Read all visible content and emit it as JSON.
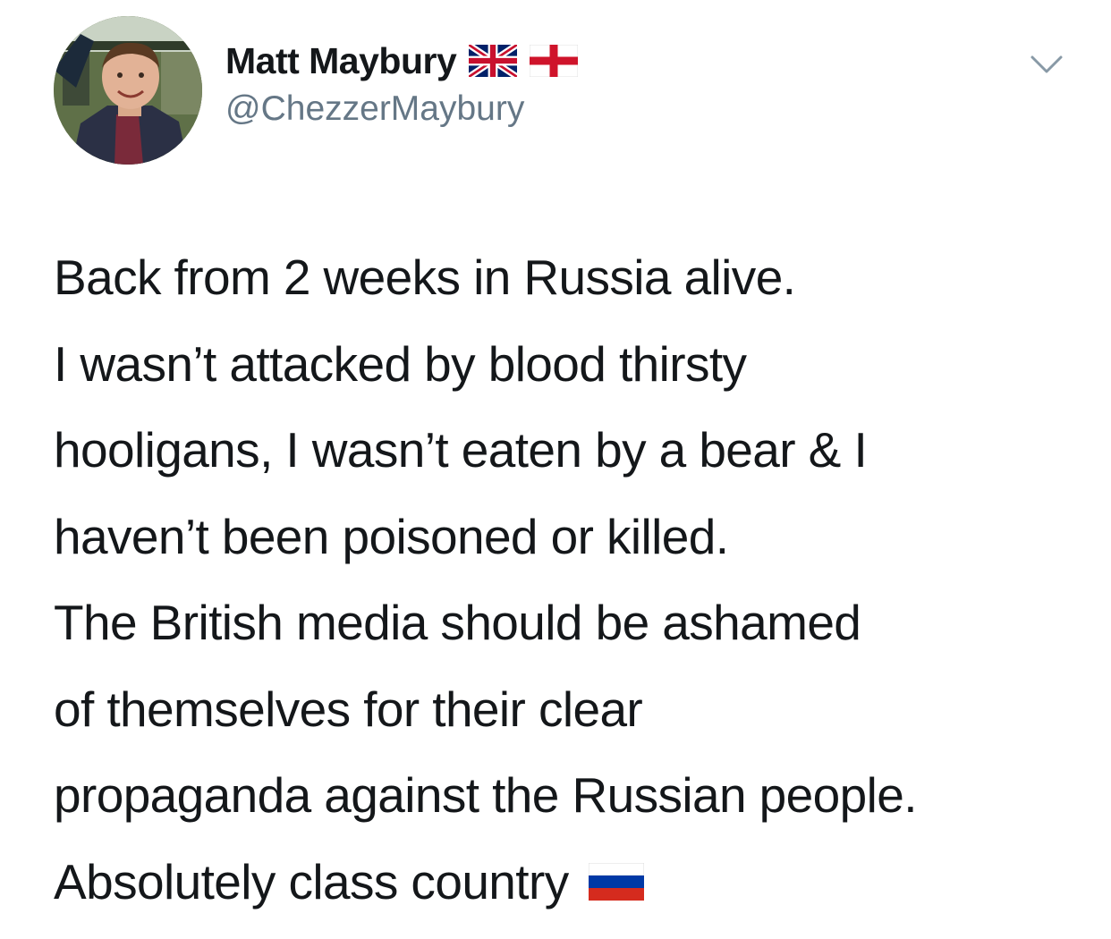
{
  "tweet": {
    "author": {
      "display_name": "Matt Maybury",
      "handle": "@ChezzerMaybury",
      "name_flags": [
        "uk-flag-icon",
        "england-flag-icon"
      ]
    },
    "menu_icon": "chevron-down-icon",
    "lines": [
      "Back from 2 weeks in Russia alive.",
      "I wasn’t attacked by blood thirsty",
      "hooligans, I wasn’t eaten by a bear & I",
      "haven’t been poisoned or killed.",
      "The British media should be ashamed",
      "of themselves for their clear",
      "propaganda against the Russian people.",
      "Absolutely class country"
    ],
    "trailing_icon": "russia-flag-icon"
  },
  "colors": {
    "text": "#14171a",
    "secondary": "#657786",
    "background": "#ffffff"
  }
}
